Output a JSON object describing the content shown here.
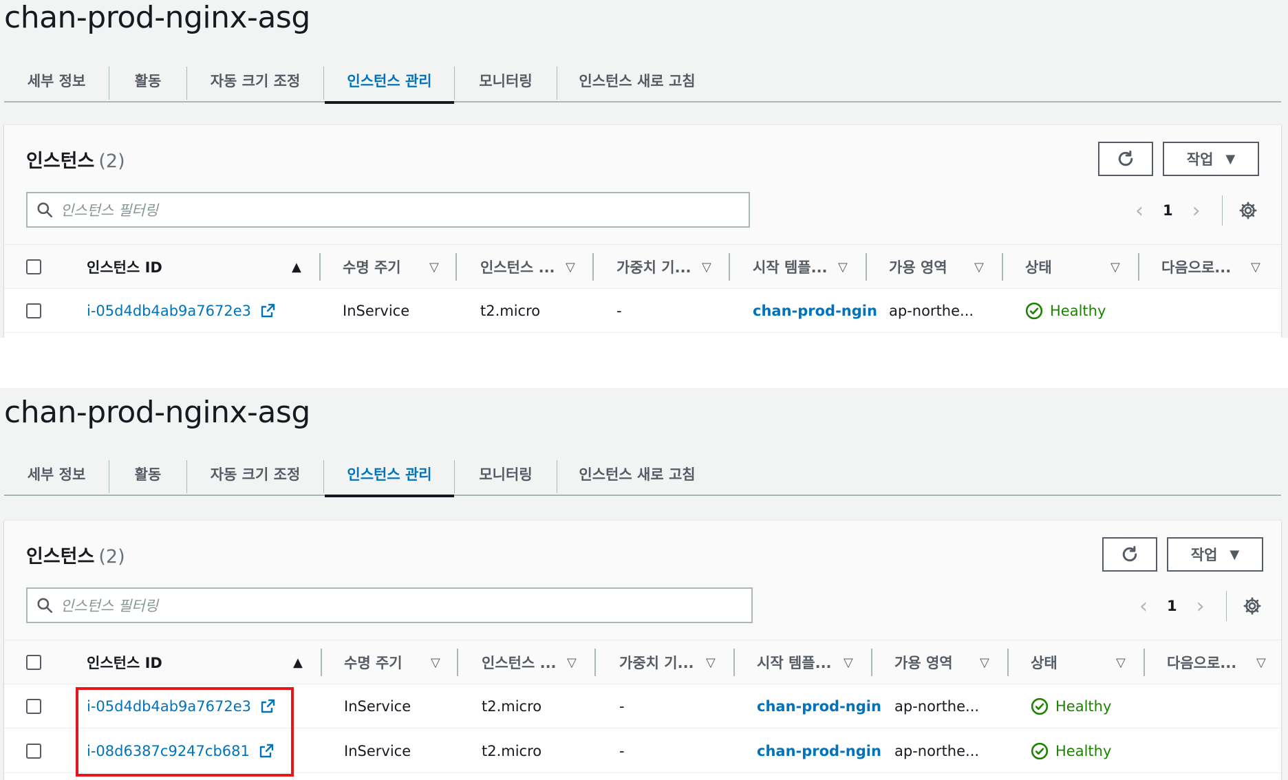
{
  "screens": [
    {
      "title": "chan-prod-nginx-asg",
      "tabs": [
        "세부 정보",
        "활동",
        "자동 크기 조정",
        "인스턴스 관리",
        "모니터링",
        "인스턴스 새로 고침"
      ],
      "active_tab": "인스턴스 관리",
      "card": {
        "title": "인스턴스",
        "count": "(2)",
        "refresh_label": "refresh",
        "action_label": "작업",
        "search_placeholder": "인스턴스 필터링",
        "page": "1"
      },
      "columns": [
        "인스턴스 ID",
        "수명 주기",
        "인스턴스 ...",
        "가중치 기...",
        "시작 템플...",
        "가용 영역",
        "상태",
        "다음으로..."
      ],
      "rows": [
        {
          "id": "i-05d4db4ab9a7672e3",
          "lifecycle": "InService",
          "type": "t2.micro",
          "weight": "-",
          "template": "chan-prod-ngin",
          "az": "ap-northe...",
          "status": "Healthy"
        }
      ]
    },
    {
      "title": "chan-prod-nginx-asg",
      "tabs": [
        "세부 정보",
        "활동",
        "자동 크기 조정",
        "인스턴스 관리",
        "모니터링",
        "인스턴스 새로 고침"
      ],
      "active_tab": "인스턴스 관리",
      "card": {
        "title": "인스턴스",
        "count": "(2)",
        "refresh_label": "refresh",
        "action_label": "작업",
        "search_placeholder": "인스턴스 필터링",
        "page": "1"
      },
      "columns": [
        "인스턴스 ID",
        "수명 주기",
        "인스턴스 ...",
        "가중치 기...",
        "시작 템플...",
        "가용 영역",
        "상태",
        "다음으로..."
      ],
      "rows": [
        {
          "id": "i-05d4db4ab9a7672e3",
          "lifecycle": "InService",
          "type": "t2.micro",
          "weight": "-",
          "template": "chan-prod-ngin",
          "az": "ap-northe...",
          "status": "Healthy"
        },
        {
          "id": "i-08d6387c9247cb681",
          "lifecycle": "InService",
          "type": "t2.micro",
          "weight": "-",
          "template": "chan-prod-ngin",
          "az": "ap-northe...",
          "status": "Healthy"
        }
      ]
    }
  ],
  "colors": {
    "link": "#0073bb",
    "healthy": "#1d8102",
    "highlight": "#e8161b",
    "text": "#16191f",
    "muted": "#545b64"
  }
}
